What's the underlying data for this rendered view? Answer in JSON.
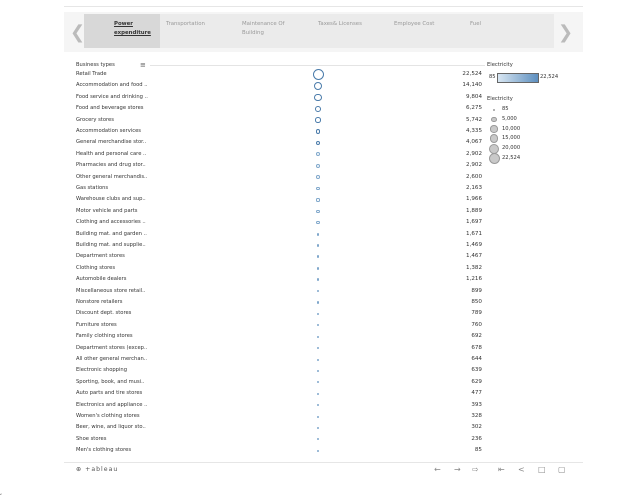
{
  "tabs": [
    {
      "label": "Power expenditure",
      "active": true
    },
    {
      "label": "Transportation",
      "active": false
    },
    {
      "label": "Maintenance Of Building",
      "active": false
    },
    {
      "label": "Taxes& Licenses",
      "active": false
    },
    {
      "label": "Employee Cost",
      "active": false
    },
    {
      "label": "Fuel",
      "active": false
    }
  ],
  "nav": {
    "prev_icon": "chevron-left-icon",
    "next_icon": "chevron-right-icon"
  },
  "table": {
    "header": "Business types",
    "sort_icon": "sort-icon",
    "rows": [
      {
        "label": "Retail Trade",
        "value": "22,524"
      },
      {
        "label": "Accommodation and food ..",
        "value": "14,140"
      },
      {
        "label": "Food service and drinking ..",
        "value": "9,804"
      },
      {
        "label": "Food and beverage stores",
        "value": "6,275"
      },
      {
        "label": "Grocery stores",
        "value": "5,742"
      },
      {
        "label": "Accommodation services",
        "value": "4,335"
      },
      {
        "label": "General merchandise stor..",
        "value": "4,067"
      },
      {
        "label": "Health and personal care ..",
        "value": "2,902"
      },
      {
        "label": "Pharmacies and drug stor..",
        "value": "2,902"
      },
      {
        "label": "Other general merchandis..",
        "value": "2,600"
      },
      {
        "label": "Gas stations",
        "value": "2,163"
      },
      {
        "label": "Warehouse clubs and sup..",
        "value": "1,966"
      },
      {
        "label": "Motor vehicle and parts",
        "value": "1,889"
      },
      {
        "label": "Clothing and accessories ..",
        "value": "1,697"
      },
      {
        "label": "Building mat. and garden ..",
        "value": "1,671"
      },
      {
        "label": "Building mat. and supplie..",
        "value": "1,469"
      },
      {
        "label": "Department stores",
        "value": "1,467"
      },
      {
        "label": "Clothing stores",
        "value": "1,382"
      },
      {
        "label": "Automobile dealers",
        "value": "1,216"
      },
      {
        "label": "Miscellaneous store retail..",
        "value": "899"
      },
      {
        "label": "Nonstore retailers",
        "value": "850"
      },
      {
        "label": "Discount dept. stores",
        "value": "789"
      },
      {
        "label": "Furniture stores",
        "value": "760"
      },
      {
        "label": "Family clothing stores",
        "value": "692"
      },
      {
        "label": "Department stores (excep..",
        "value": "678"
      },
      {
        "label": "All other general merchan..",
        "value": "644"
      },
      {
        "label": "Electronic shopping",
        "value": "639"
      },
      {
        "label": "Sporting, book, and musi..",
        "value": "629"
      },
      {
        "label": "Auto parts and tire stores",
        "value": "477"
      },
      {
        "label": "Electronics and appliance ..",
        "value": "393"
      },
      {
        "label": "Women's clothing stores",
        "value": "328"
      },
      {
        "label": "Beer, wine, and liquor sto..",
        "value": "302"
      },
      {
        "label": "Shoe stores",
        "value": "236"
      },
      {
        "label": "Men's clothing stores",
        "value": "85"
      }
    ]
  },
  "legend": {
    "color_title": "Electricity",
    "color_min": "85",
    "color_max": "22,524",
    "color_low": "#d8e6f2",
    "color_high": "#5d8fbf",
    "size_title": "Electricity",
    "size_items": [
      {
        "label": "85",
        "value": 85
      },
      {
        "label": "5,000",
        "value": 5000
      },
      {
        "label": "10,000",
        "value": 10000
      },
      {
        "label": "15,000",
        "value": 15000
      },
      {
        "label": "20,000",
        "value": 20000
      },
      {
        "label": "22,524",
        "value": 22524
      }
    ]
  },
  "toolbar": {
    "logo": "+ableau",
    "icons": [
      "undo-icon",
      "redo-icon",
      "revert-icon",
      "reset-icon",
      "share-icon",
      "comment-icon",
      "fullscreen-icon"
    ]
  }
}
